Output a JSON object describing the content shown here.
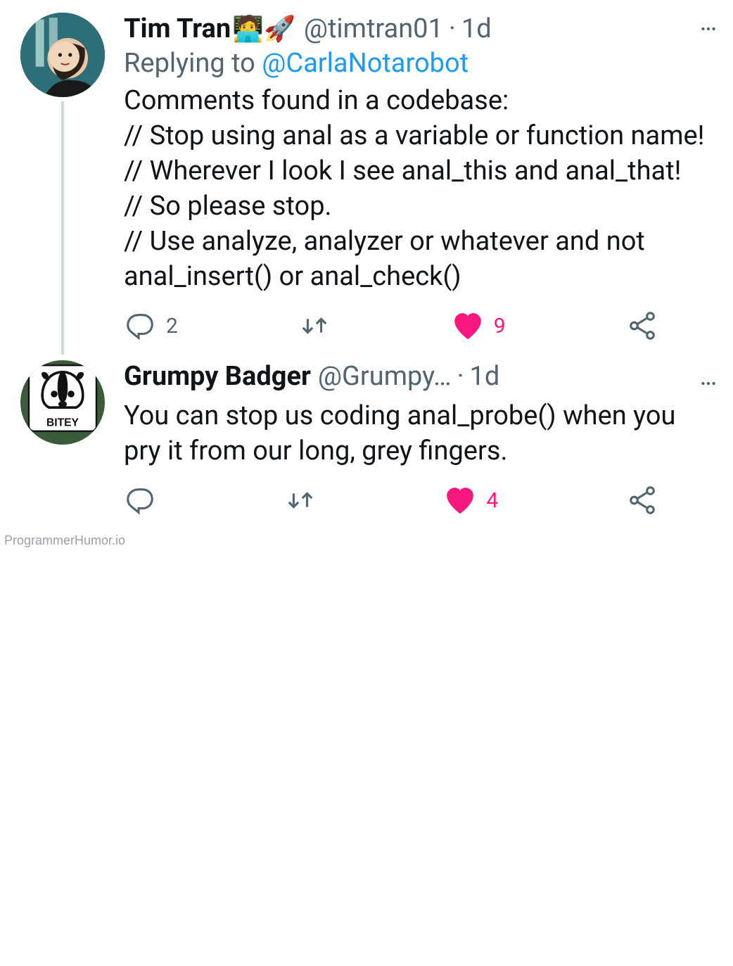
{
  "tweets": [
    {
      "display_name": "Tim Tran",
      "emojis": "🧑‍💻🚀",
      "handle": "@timtran01",
      "dot": "·",
      "time": "1d",
      "replying_prefix": "Replying to ",
      "replying_to": "@CarlaNotarobot",
      "body": "Comments found in a codebase:\n// Stop using anal as a variable or function name!\n// Wherever I look I see anal_this and anal_that!\n// So please stop.\n// Use analyze, analyzer or whatever and not anal_insert() or anal_check()",
      "reply_count": "2",
      "like_count": "9"
    },
    {
      "display_name": "Grumpy Badger",
      "handle": "@Grumpy…",
      "dot": "·",
      "time": "1d",
      "body": "You can stop us coding anal_probe() when you pry it from our long, grey fingers.",
      "like_count": "4"
    }
  ],
  "watermark": "ProgrammerHumor.io"
}
